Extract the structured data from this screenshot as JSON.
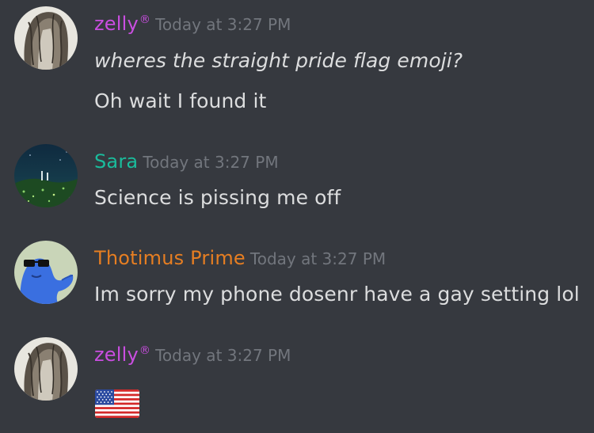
{
  "colors": {
    "background": "#36393f",
    "timestamp": "#72767d",
    "message_text": "#dcddde",
    "zelly_name": "#c94ee0",
    "sara_name": "#1abc9c",
    "thotimus_name": "#e67e22"
  },
  "messages": [
    {
      "author": "zelly",
      "badge": "®",
      "timestamp": "Today at 3:27 PM",
      "avatar_icon": "long-hair-girl-avatar",
      "lines": [
        "wheres the straight pride flag emoji?",
        "Oh wait I found it"
      ]
    },
    {
      "author": "Sara",
      "timestamp": "Today at 3:27 PM",
      "avatar_icon": "night-forest-avatar",
      "lines": [
        "Science is pissing me off"
      ]
    },
    {
      "author": "Thotimus Prime",
      "timestamp": "Today at 3:27 PM",
      "avatar_icon": "blue-sunglasses-blob-avatar",
      "lines": [
        "Im sorry my phone dosenr have a gay setting lol"
      ]
    },
    {
      "author": "zelly",
      "badge": "®",
      "timestamp": "Today at 3:27 PM",
      "avatar_icon": "long-hair-girl-avatar",
      "emoji_icon": "us-flag-emoji"
    }
  ]
}
